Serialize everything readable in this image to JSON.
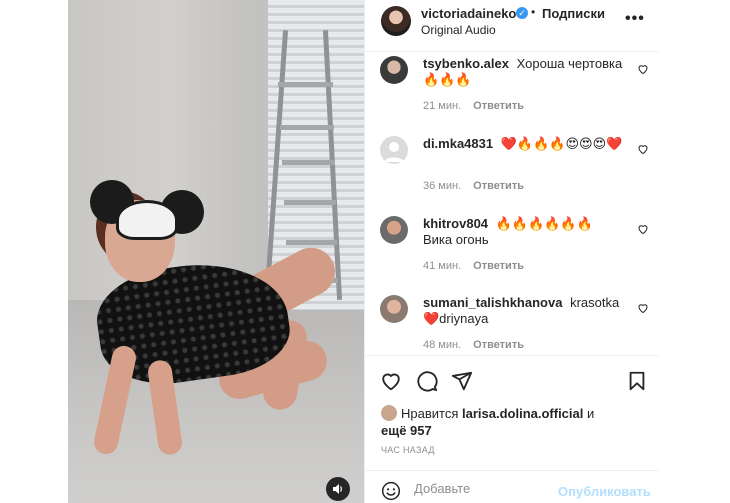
{
  "media": {
    "sound_icon": "speaker-icon"
  },
  "post": {
    "author": "victoriadaineko",
    "verified_icon": "verified-badge-icon",
    "separator": "•",
    "follow_label": "Подписки",
    "audio": "Original Audio",
    "more_icon": "more-options-icon"
  },
  "comments": [
    {
      "username": "tsybenko.alex",
      "text": "Хороша чертовка",
      "emoji_line": "🔥🔥🔥",
      "time": "21 мин.",
      "reply": "Ответить"
    },
    {
      "username": "di.mka4831",
      "text": "",
      "emoji_line": "❤️🔥🔥🔥😍😍😍❤️",
      "time": "36 мин.",
      "reply": "Ответить"
    },
    {
      "username": "khitrov804",
      "text": "🔥🔥🔥🔥🔥🔥",
      "emoji_line": "Вика огонь",
      "time": "41 мин.",
      "reply": "Ответить"
    },
    {
      "username": "sumani_talishkhanova",
      "text": "krasotka",
      "emoji_line": "❤️driynaya",
      "time": "48 мин.",
      "reply": "Ответить"
    }
  ],
  "actions": {
    "like_icon": "heart-icon",
    "comment_icon": "comment-icon",
    "share_icon": "share-icon",
    "save_icon": "bookmark-icon"
  },
  "likes": {
    "prefix": "Нравится",
    "liker": "larisa.dolina.official",
    "connector": "и",
    "others": "ещё 957"
  },
  "timestamp": "ЧАС НАЗАД",
  "add_comment": {
    "emoji_icon": "smiley-icon",
    "placeholder": "Добавьте",
    "publish_label": "Опубликовать"
  },
  "colors": {
    "link_disabled": "#b2dffc",
    "verified": "#3897f0",
    "muted_text": "#8e8e8e"
  }
}
